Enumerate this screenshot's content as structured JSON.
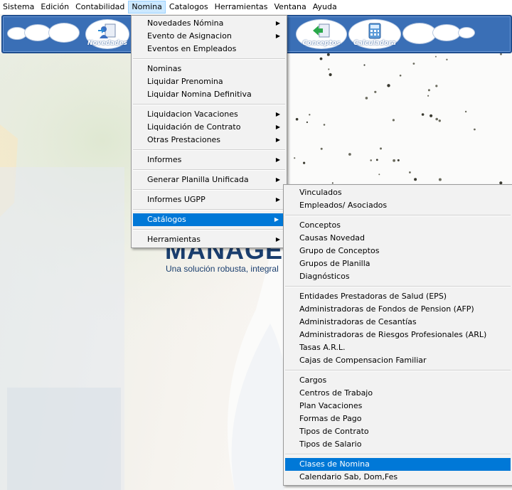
{
  "menubar": {
    "items": [
      "Sistema",
      "Edición",
      "Contabilidad",
      "Nomina",
      "Catalogos",
      "Herramientas",
      "Ventana",
      "Ayuda"
    ]
  },
  "toolbar": {
    "novedades_label": "Novedades",
    "conceptos_label": "Conceptos",
    "calculadora_label": "Calculadora"
  },
  "background": {
    "brand_text": "MANAGE",
    "tagline": "Una solución robusta, integral"
  },
  "nomina_menu": {
    "items": [
      {
        "label": "Novedades Nómina",
        "submenu": true
      },
      {
        "label": "Evento de Asignacion",
        "submenu": true
      },
      {
        "label": "Eventos en Empleados",
        "submenu": false
      },
      {
        "label": "Nominas",
        "submenu": false
      },
      {
        "label": "Liquidar Prenomina",
        "submenu": false
      },
      {
        "label": "Liquidar Nomina Definitiva",
        "submenu": false
      },
      {
        "label": "Liquidacion Vacaciones",
        "submenu": true
      },
      {
        "label": "Liquidación de Contrato",
        "submenu": true
      },
      {
        "label": "Otras Prestaciones",
        "submenu": true
      },
      {
        "label": "Informes",
        "submenu": true
      },
      {
        "label": "Generar Planilla Unificada",
        "submenu": true
      },
      {
        "label": "Informes UGPP",
        "submenu": true
      },
      {
        "label": "Catálogos",
        "submenu": true
      },
      {
        "label": "Herramientas",
        "submenu": true
      }
    ]
  },
  "catalogos_menu": {
    "items": [
      "Vinculados",
      "Empleados/ Asociados",
      "Conceptos",
      "Causas Novedad",
      "Grupo de Conceptos",
      "Grupos de Planilla",
      "Diagnósticos",
      "Entidades Prestadoras de Salud (EPS)",
      "Administradoras de Fondos de Pension (AFP)",
      "Administradoras de Cesantías",
      "Administradoras de Riesgos Profesionales (ARL)",
      "Tasas A.R.L.",
      "Cajas de Compensacion Familiar",
      "Cargos",
      "Centros de Trabajo",
      "Plan Vacaciones",
      "Formas de Pago",
      "Tipos de Contrato",
      "Tipos de Salario",
      "Clases de Nomina",
      "Calendario Sab, Dom,Fes"
    ]
  },
  "colors": {
    "highlight": "#0078d7",
    "toolbar": "#3a6fb6",
    "menubar_active": "#cce8ff"
  }
}
